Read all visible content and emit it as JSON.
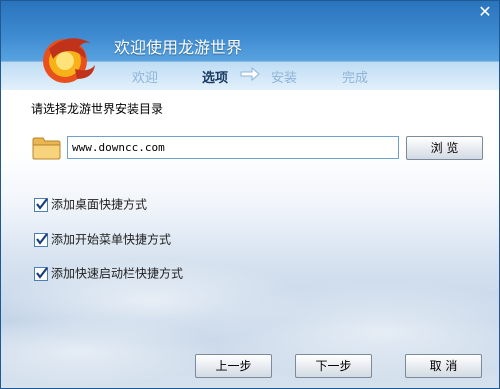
{
  "window": {
    "title": "欢迎使用龙游世界",
    "close_glyph": "✕"
  },
  "steps": [
    {
      "label": "欢迎",
      "active": false
    },
    {
      "label": "选项",
      "active": true
    },
    {
      "label": "安装",
      "active": false
    },
    {
      "label": "完成",
      "active": false
    }
  ],
  "content": {
    "prompt": "请选择龙游世界安装目录",
    "install_path": "www.downcc.com",
    "browse_label": "浏 览",
    "options": [
      {
        "label": "添加桌面快捷方式",
        "checked": true
      },
      {
        "label": "添加开始菜单快捷方式",
        "checked": true
      },
      {
        "label": "添加快速启动栏快捷方式",
        "checked": true
      }
    ]
  },
  "footer": {
    "prev_label": "上一步",
    "next_label": "下一步",
    "cancel_label": "取 消"
  },
  "colors": {
    "header": "#3e8bd1",
    "step_active": "#1a3b63",
    "step_inactive": "#8fb4d8"
  }
}
